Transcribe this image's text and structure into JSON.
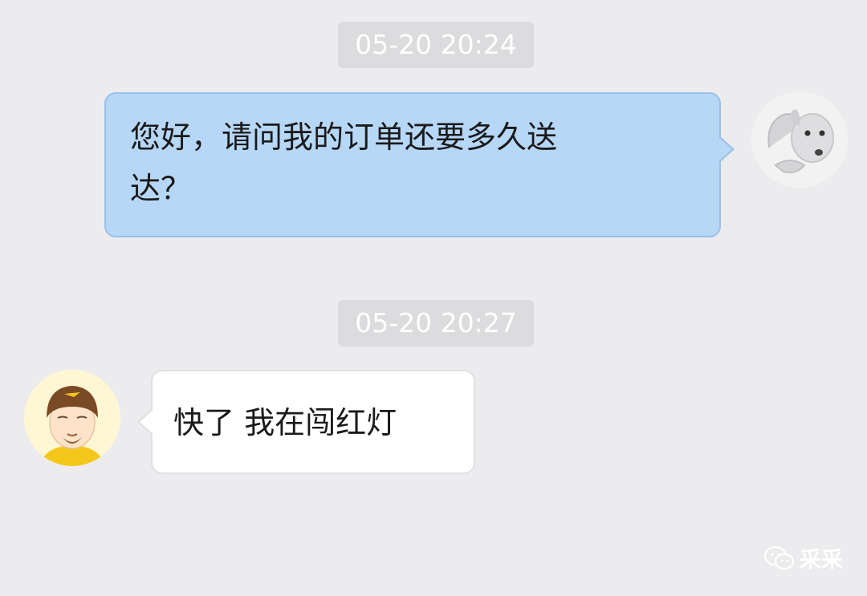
{
  "chat": {
    "messages": [
      {
        "timestamp": "05-20 20:24",
        "sender": "self",
        "avatar_icon": "cartoon-dog-avatar",
        "line1": "您好，请问我的订单还要多久送",
        "line2": "达？"
      },
      {
        "timestamp": "05-20 20:27",
        "sender": "courier",
        "avatar_icon": "delivery-rider-helmet-avatar",
        "text": "快了 我在闯红灯"
      }
    ]
  },
  "watermark": {
    "icon": "wechat-icon",
    "text": "采采"
  },
  "colors": {
    "background": "#ececee",
    "outgoing_bubble": "#b7d7f7",
    "incoming_bubble": "#ffffff",
    "timestamp_bg": "#dcdcde"
  }
}
